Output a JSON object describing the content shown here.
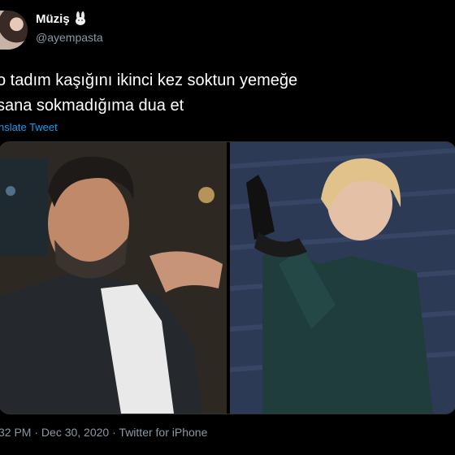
{
  "user": {
    "display_name": "Müziş",
    "handle": "@ayempasta",
    "badge_icon": "rabbit-icon"
  },
  "tweet": {
    "line1": "o tadım kaşığını ikinci kez soktun yemeğe",
    "line2": "sana sokmadığıma dua et",
    "translate_label": "nslate Tweet"
  },
  "meta": {
    "time": "32 PM",
    "separator1": " · ",
    "date": "Dec 30, 2020",
    "separator2": " · ",
    "source": "Twitter for iPhone"
  },
  "colors": {
    "background": "#000000",
    "link": "#1d9bf0",
    "secondary_text": "#8b98a5"
  }
}
